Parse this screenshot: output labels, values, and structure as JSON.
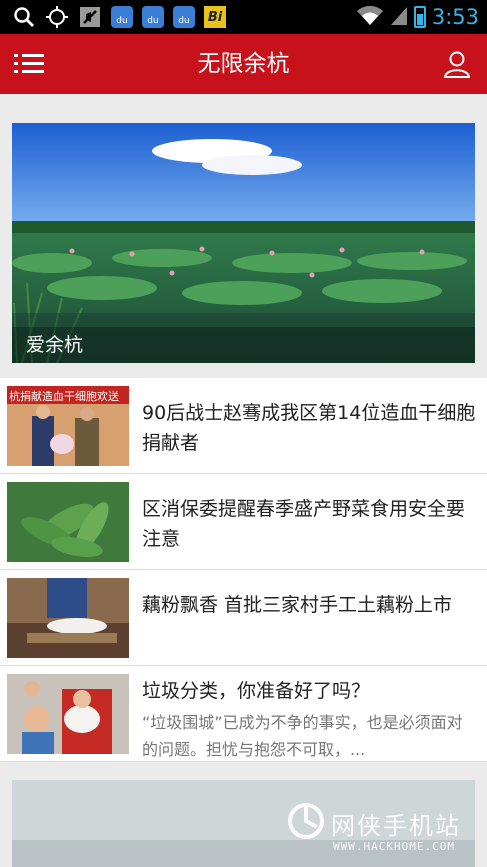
{
  "status_bar": {
    "time": "3:53",
    "icons": [
      "search-icon",
      "gps-icon",
      "muted-icon",
      "baidu-icon",
      "baidu-icon",
      "baidu-icon",
      "bi-app-icon",
      "wifi-icon",
      "signal-icon",
      "battery-icon"
    ],
    "baidu_label": "du",
    "bi_label": "Bi"
  },
  "header": {
    "title": "无限余杭",
    "background": "#c8121b"
  },
  "banner": {
    "caption": "爱余杭"
  },
  "news": [
    {
      "title": "90后战士赵骞成我区第14位造血干细胞捐献者",
      "summary": "",
      "thumb_text": "杭捐献造血干细胞欢送"
    },
    {
      "title": "区消保委提醒春季盛产野菜食用安全要注意",
      "summary": ""
    },
    {
      "title": "藕粉飘香 首批三家村手工土藕粉上市",
      "summary": ""
    },
    {
      "title": "垃圾分类，你准备好了吗？",
      "summary": "“垃圾围城”已成为不争的事实，也是必须面对的问题。担忧与抱怨不可取，..."
    }
  ],
  "watermark": {
    "name": "网侠手机站",
    "url": "WWW.HACKHOME.COM"
  }
}
